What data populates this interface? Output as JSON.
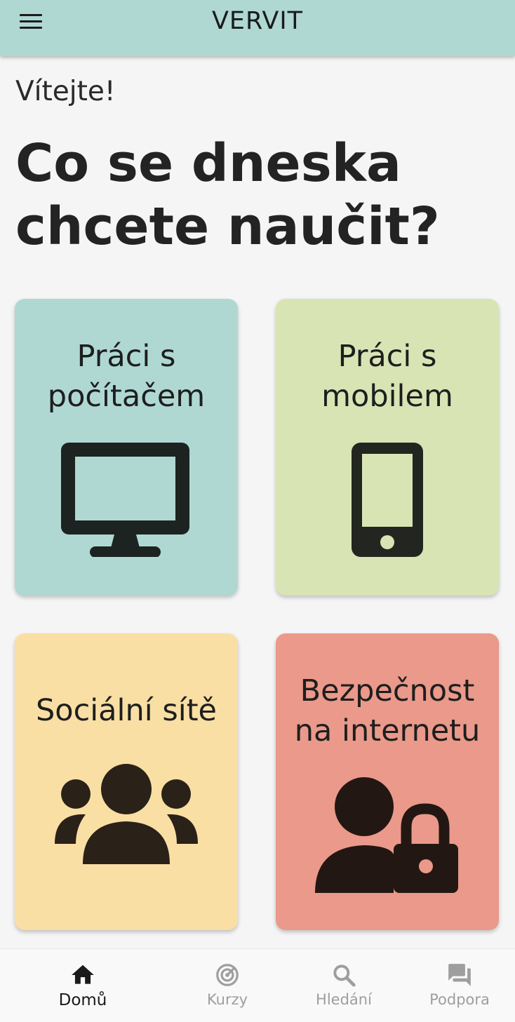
{
  "header": {
    "title": "VERVIT",
    "menu_icon": "hamburger-menu-icon"
  },
  "main": {
    "greeting": "Vítejte!",
    "headline_line1": "Co se dneska",
    "headline_line2": "chcete naučit?"
  },
  "cards": [
    {
      "line1": "Práci s",
      "line2": "počítačem",
      "icon": "desktop-monitor-icon",
      "color": "#afd8d3"
    },
    {
      "line1": "Práci s",
      "line2": "mobilem",
      "icon": "smartphone-icon",
      "color": "#d9e4b4"
    },
    {
      "line1": "Sociální sítě",
      "line2": "",
      "icon": "people-group-icon",
      "color": "#f9dfa4"
    },
    {
      "line1": "Bezpečnost",
      "line2": "na internetu",
      "icon": "user-lock-icon",
      "color": "#ea998a"
    }
  ],
  "bottom_nav": {
    "active_index": 0,
    "items": [
      {
        "label": "Domů",
        "icon": "home-icon"
      },
      {
        "label": "Kurzy",
        "icon": "radar-target-icon"
      },
      {
        "label": "Hledání",
        "icon": "search-icon"
      },
      {
        "label": "Podpora",
        "icon": "forum-chat-icon"
      }
    ]
  },
  "colors": {
    "accent": "#afd8d3",
    "icon_dark": "#231f1c",
    "nav_inactive": "#9e9e9e"
  }
}
